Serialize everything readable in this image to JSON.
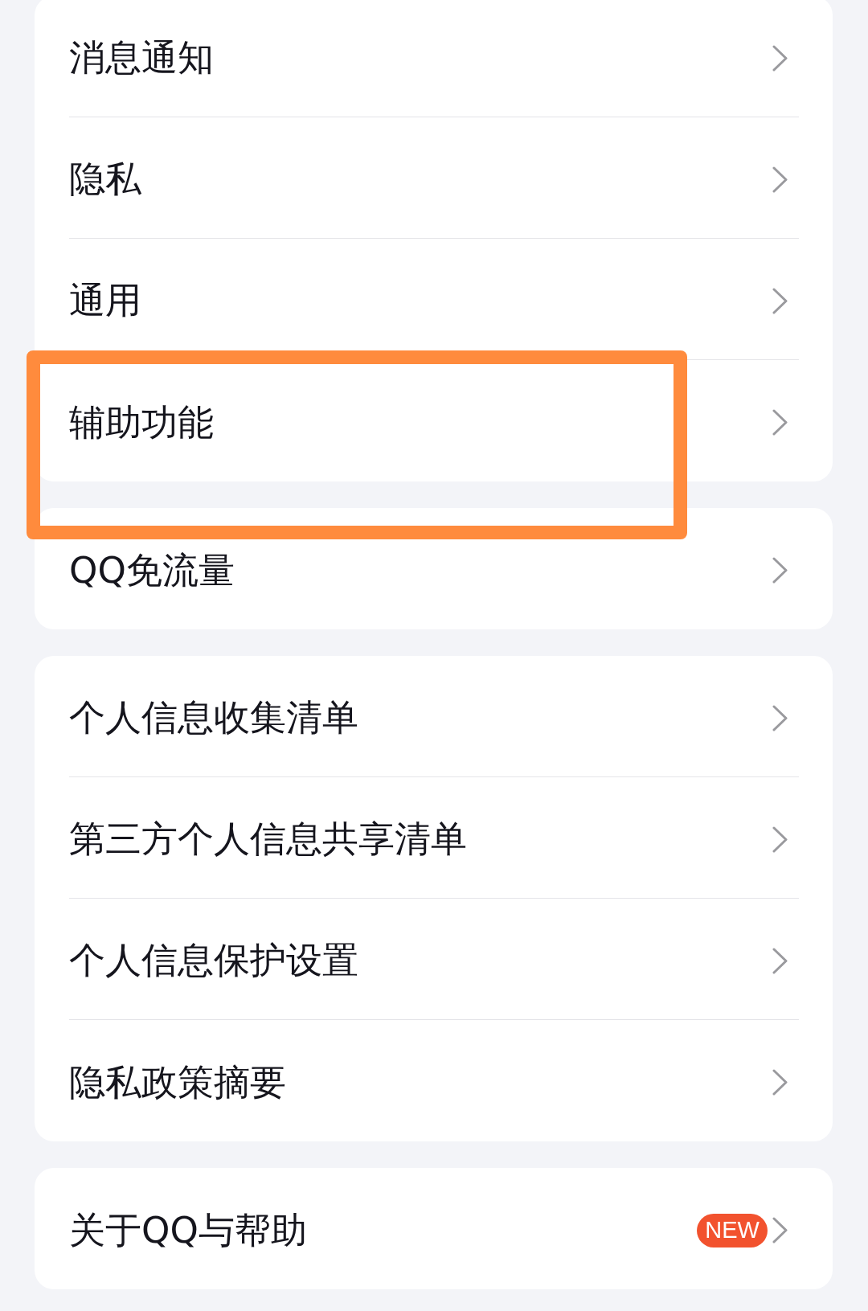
{
  "groups": [
    {
      "items": [
        {
          "label": "消息通知",
          "highlighted": false
        },
        {
          "label": "隐私",
          "highlighted": false
        },
        {
          "label": "通用",
          "highlighted": false
        },
        {
          "label": "辅助功能",
          "highlighted": true
        }
      ]
    },
    {
      "items": [
        {
          "label": "QQ免流量",
          "highlighted": false
        }
      ]
    },
    {
      "items": [
        {
          "label": "个人信息收集清单",
          "highlighted": false
        },
        {
          "label": "第三方个人信息共享清单",
          "highlighted": false
        },
        {
          "label": "个人信息保护设置",
          "highlighted": false
        },
        {
          "label": "隐私政策摘要",
          "highlighted": false
        }
      ]
    },
    {
      "items": [
        {
          "label": "关于QQ与帮助",
          "highlighted": false,
          "badge": "NEW"
        }
      ]
    }
  ]
}
